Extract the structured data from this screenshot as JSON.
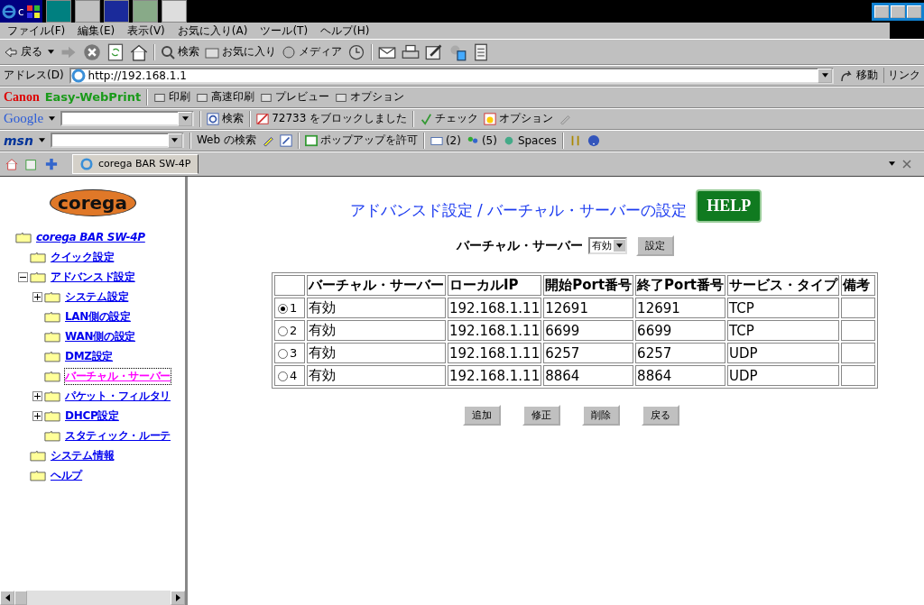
{
  "taskbar": {
    "start_label": "c"
  },
  "menu": [
    "ファイル(F)",
    "編集(E)",
    "表示(V)",
    "お気に入り(A)",
    "ツール(T)",
    "ヘルプ(H)"
  ],
  "toolbar": {
    "back": "戻る",
    "search": "検索",
    "favorites": "お気に入り",
    "media": "メディア"
  },
  "address": {
    "label": "アドレス(D)",
    "value": "http://192.168.1.1",
    "go": "移動",
    "links": "リンク"
  },
  "canon_bar": {
    "brand": "Canon",
    "product": "Easy-WebPrint",
    "buttons": [
      "印刷",
      "高速印刷",
      "プレビュー",
      "オプション"
    ]
  },
  "google_bar": {
    "logo": "Google",
    "search": "検索",
    "blocked": "72733 をブロックしました",
    "check": "チェック",
    "options": "オプション"
  },
  "msn_bar": {
    "logo": "msn",
    "web_search": "Web の検索",
    "popup": "ポップアップを許可",
    "mail": "(2)",
    "contacts": "(5)",
    "spaces": "Spaces"
  },
  "tab": {
    "title": "corega BAR SW-4P"
  },
  "sidebar": {
    "logo": "corega",
    "tree": [
      {
        "label": "corega BAR SW-4P",
        "selected": false,
        "children": [
          {
            "label": "クイック設定",
            "selected": false
          },
          {
            "label": "アドバンスド設定",
            "selected": false,
            "expanded": true,
            "children": [
              {
                "label": "システム設定",
                "selected": false,
                "expanded": false
              },
              {
                "label": "LAN側の設定",
                "selected": false
              },
              {
                "label": "WAN側の設定",
                "selected": false
              },
              {
                "label": "DMZ設定",
                "selected": false
              },
              {
                "label": "バーチャル・サーバー",
                "selected": true
              },
              {
                "label": "パケット・フィルタリ",
                "selected": false,
                "expanded": false
              },
              {
                "label": "DHCP設定",
                "selected": false,
                "expanded": false
              },
              {
                "label": "スタティック・ルーテ",
                "selected": false
              }
            ]
          },
          {
            "label": "システム情報",
            "selected": false
          },
          {
            "label": "ヘルプ",
            "selected": false
          }
        ]
      }
    ]
  },
  "main": {
    "title": "アドバンスド設定 / バーチャル・サーバーの設定",
    "help": "HELP",
    "control_label": "バーチャル・サーバー",
    "select_value": "有効",
    "apply": "設定",
    "table": {
      "columns": [
        "バーチャル・サーバー",
        "ローカルIP",
        "開始Port番号",
        "終了Port番号",
        "サービス・タイプ",
        "備考"
      ],
      "rows": [
        {
          "selected": true,
          "index": "1",
          "cells": [
            "有効",
            "192.168.1.11",
            "12691",
            "12691",
            "TCP"
          ]
        },
        {
          "selected": false,
          "index": "2",
          "cells": [
            "有効",
            "192.168.1.11",
            "6699",
            "6699",
            "TCP"
          ]
        },
        {
          "selected": false,
          "index": "3",
          "cells": [
            "有効",
            "192.168.1.11",
            "6257",
            "6257",
            "UDP"
          ]
        },
        {
          "selected": false,
          "index": "4",
          "cells": [
            "有効",
            "192.168.1.11",
            "8864",
            "8864",
            "UDP"
          ]
        }
      ]
    },
    "buttons": [
      "追加",
      "修正",
      "削除",
      "戻る"
    ]
  }
}
